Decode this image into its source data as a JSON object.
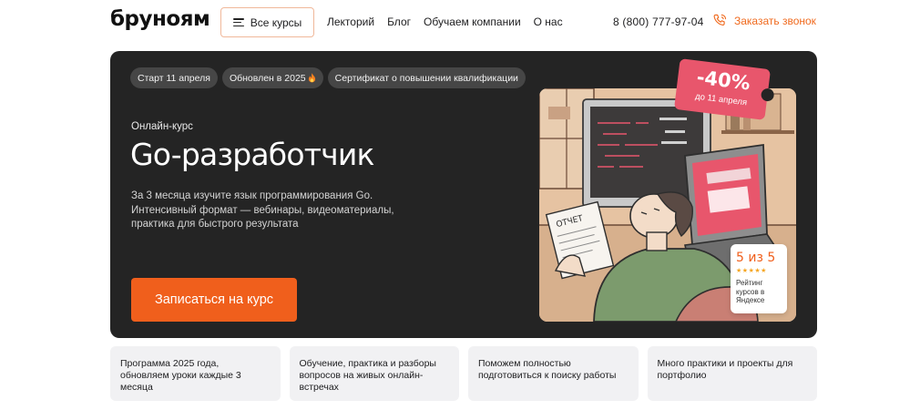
{
  "brand": {
    "logo_text": "бруноям"
  },
  "header": {
    "courses_button": "Все курсы",
    "nav": [
      "Лекторий",
      "Блог",
      "Обучаем компании",
      "О нас"
    ],
    "phone": "8 (800) 777-97-04",
    "callback": "Заказать звонок"
  },
  "hero": {
    "tags": [
      "Старт 11 апреля",
      "Обновлен в 2025",
      "Сертификат о повышении квалификации"
    ],
    "tag_icon": "fire-icon",
    "eyebrow": "Онлайн-курс",
    "title": "Go-разработчик",
    "description": "За 3 месяца изучите язык программирования Go. Интенсивный формат — вебинары, видеоматериалы, практика для быстрого результата",
    "cta": "Записаться на курс",
    "discount": {
      "percent": "-40%",
      "until": "до 11 апреля"
    },
    "illustration_texts": {
      "paper_label": "ОТЧЕТ"
    },
    "rating": {
      "score": "5 из 5",
      "stars": 5,
      "caption": "Рейтинг курсов в Яндексе"
    }
  },
  "features": [
    "Программа 2025 года, обновляем уроки каждые 3 месяца",
    "Обучение, практика и разборы вопросов на живых онлайн-встречах",
    "Поможем полностью подготовиться к поиску работы",
    "Много практики и проекты для портфолио"
  ],
  "colors": {
    "accent": "#f05f1c",
    "hero_bg": "#242424",
    "tag_bg": "#464646",
    "discount_bg": "#e8566c",
    "feature_bg": "#f1f1f3"
  }
}
